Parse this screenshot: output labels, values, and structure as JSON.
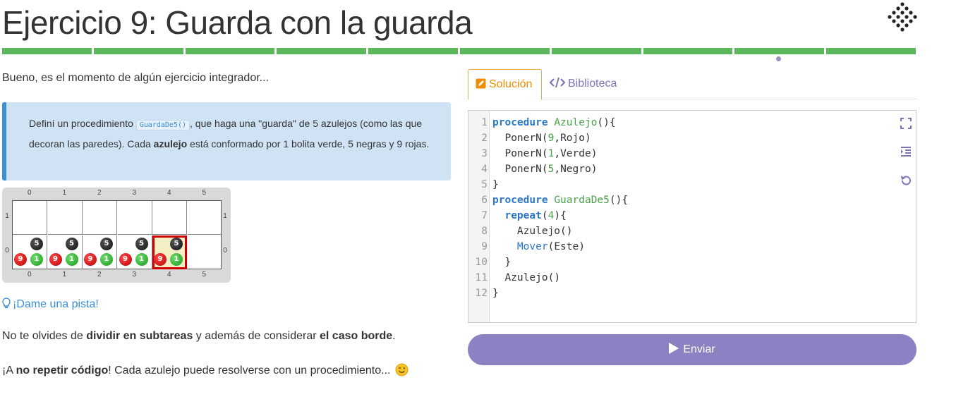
{
  "header": {
    "title": "Ejercicio 9: Guarda con la guarda",
    "progress_segments": 10,
    "progress_color": "#5cb85c",
    "logo_icon": "gobstones-logo-icon"
  },
  "statement": {
    "intro": "Bueno, es el momento de algún ejercicio integrador...",
    "callout": {
      "text_before": "Definí un procedimiento ",
      "code": "GuardaDe5()",
      "text_mid": ", que haga una \"guarda\" de 5 azulejos (como las que decoran las paredes). Cada ",
      "bold": "azulejo",
      "text_after": " está conformado por 1 bolita verde, 5 negras y 9 rojas."
    },
    "board": {
      "columns": [
        "0",
        "1",
        "2",
        "3",
        "4",
        "5"
      ],
      "rows": [
        "1",
        "0"
      ],
      "cells_with_balls": [
        {
          "col": 0,
          "red": "9",
          "green": "1",
          "black": "5"
        },
        {
          "col": 1,
          "red": "9",
          "green": "1",
          "black": "5"
        },
        {
          "col": 2,
          "red": "9",
          "green": "1",
          "black": "5"
        },
        {
          "col": 3,
          "red": "9",
          "green": "1",
          "black": "5"
        },
        {
          "col": 4,
          "red": "9",
          "green": "1",
          "black": "5"
        }
      ],
      "cursor_col": 4,
      "cursor_row": 0
    },
    "hint_label": "¡Dame una pista!",
    "p1": {
      "a": "No te olvides de ",
      "b1": "dividir en subtareas",
      "c": " y además de considerar ",
      "b2": "el caso borde",
      "d": "."
    },
    "p2": {
      "a": "¡A ",
      "b1": "no repetir código",
      "c": "! Cada azulejo puede resolverse con un procedimiento... "
    }
  },
  "editor": {
    "tabs": [
      {
        "label": "Solución",
        "icon": "edit-icon",
        "active": true
      },
      {
        "label": "Biblioteca",
        "icon": "code-icon",
        "active": false
      }
    ],
    "line_numbers": [
      "1",
      "2",
      "3",
      "4",
      "5",
      "6",
      "7",
      "8",
      "9",
      "10",
      "11",
      "12"
    ],
    "code": [
      "procedure Azulejo(){",
      "  PonerN(9,Rojo)",
      "  PonerN(1,Verde)",
      "  PonerN(5,Negro)",
      "}",
      "procedure GuardaDe5(){",
      "  repeat(4){",
      "    Azulejo()",
      "    Mover(Este)",
      "  }",
      "  Azulejo()",
      "}"
    ],
    "tools": [
      "fullscreen-icon",
      "indent-icon",
      "reset-icon"
    ]
  },
  "submit_label": "Enviar",
  "colors": {
    "accent": "#8c81c2",
    "tab_active": "#f08c00",
    "link": "#3a8fd9"
  }
}
